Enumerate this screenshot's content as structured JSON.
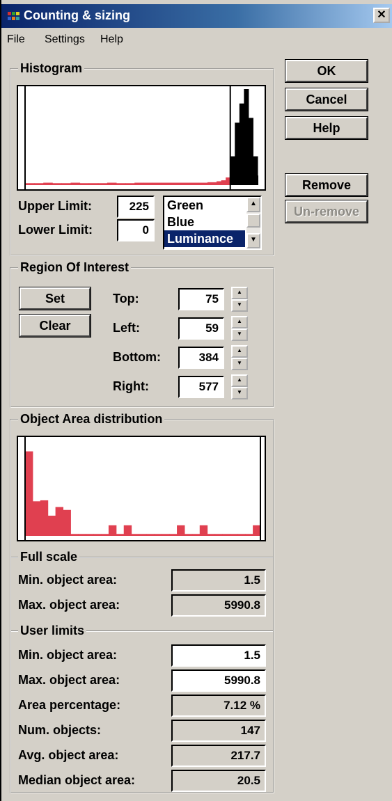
{
  "window": {
    "title": "Counting & sizing",
    "close_glyph": "✕"
  },
  "menu": {
    "items": [
      "File",
      "Settings",
      "Help"
    ]
  },
  "buttons": {
    "ok": "OK",
    "cancel": "Cancel",
    "help": "Help",
    "remove": "Remove",
    "unremove": "Un-remove"
  },
  "histogram": {
    "legend": "Histogram",
    "upper_limit_label": "Upper Limit:",
    "upper_limit_value": "225",
    "lower_limit_label": "Lower Limit:",
    "lower_limit_value": "0",
    "channel_options": [
      "Green",
      "Blue",
      "Luminance"
    ],
    "selected_channel": "Luminance"
  },
  "roi": {
    "legend": "Region Of Interest",
    "set_label": "Set",
    "clear_label": "Clear",
    "fields": [
      {
        "label": "Top:",
        "value": "75"
      },
      {
        "label": "Left:",
        "value": "59"
      },
      {
        "label": "Bottom:",
        "value": "384"
      },
      {
        "label": "Right:",
        "value": "577"
      }
    ]
  },
  "area_distribution": {
    "legend": "Object Area distribution",
    "full_scale": {
      "legend": "Full scale",
      "min_label": "Min. object area:",
      "min_value": "1.5",
      "max_label": "Max. object area:",
      "max_value": "5990.8"
    },
    "user_limits": {
      "legend": "User limits",
      "rows": [
        {
          "label": "Min. object area:",
          "value": "1.5",
          "editable": true
        },
        {
          "label": "Max. object area:",
          "value": "5990.8",
          "editable": true
        },
        {
          "label": "Area percentage:",
          "value": "7.12 %",
          "editable": false
        },
        {
          "label": "Num. objects:",
          "value": "147",
          "editable": false
        },
        {
          "label": "Avg. object area:",
          "value": "217.7",
          "editable": false
        },
        {
          "label": "Median object area:",
          "value": "20.5",
          "editable": false
        }
      ]
    }
  },
  "colors": {
    "title_bar": "#0a246a",
    "red_bar": "#e04050",
    "selection": "#0a246a",
    "face": "#d4d0c8"
  },
  "chart_data": [
    {
      "type": "area",
      "x": [
        0,
        10,
        20,
        30,
        40,
        50,
        60,
        70,
        80,
        90,
        100,
        110,
        120,
        130,
        140,
        150,
        160,
        170,
        180,
        190,
        200,
        210,
        215,
        220,
        225,
        230,
        235,
        240,
        245,
        250,
        255
      ],
      "values": [
        0.02,
        0.02,
        0.025,
        0.02,
        0.02,
        0.025,
        0.02,
        0.02,
        0.02,
        0.025,
        0.02,
        0.02,
        0.025,
        0.025,
        0.025,
        0.025,
        0.025,
        0.025,
        0.025,
        0.025,
        0.03,
        0.04,
        0.05,
        0.08,
        0.3,
        0.65,
        0.85,
        1.0,
        0.7,
        0.3,
        0.1
      ],
      "xlim": [
        0,
        255
      ],
      "ylim": [
        0,
        1
      ],
      "upper_limit": 225,
      "lower_limit": 0
    },
    {
      "type": "bar",
      "values": [
        0.88,
        0.36,
        0.37,
        0.21,
        0.3,
        0.27,
        0.02,
        0.02,
        0.02,
        0.02,
        0.02,
        0.11,
        0.02,
        0.11,
        0.02,
        0.02,
        0.02,
        0.02,
        0.02,
        0.02,
        0.11,
        0.02,
        0.02,
        0.11,
        0.02,
        0.02,
        0.02,
        0.02,
        0.02,
        0.02,
        0.11
      ],
      "ylim": [
        0,
        1
      ]
    }
  ]
}
